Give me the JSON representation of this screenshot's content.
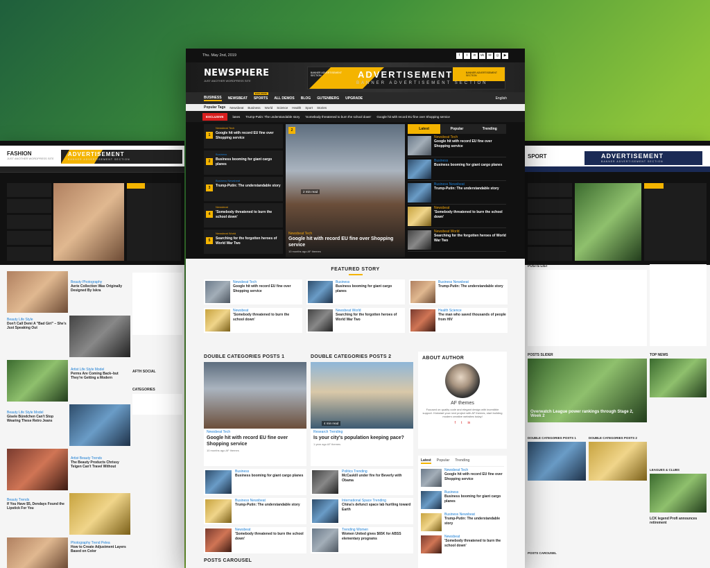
{
  "main": {
    "date": "Thu. May 2nd, 2019",
    "social": [
      "f",
      "t",
      "in",
      "vk",
      "✉",
      "◎",
      "▶"
    ],
    "logo": "NEWSPHERE",
    "slogan": "JUST ANOTHER WORDPRESS SITE",
    "ad": {
      "big": "ADVERTISEMENT",
      "sub": "BANNER ADVERTISEMENT SECTION",
      "small_left": "BANNER ADVERTISEMENT SECTION",
      "small_right": "BANNER ADVERTISEMENT SECTION"
    },
    "nav": [
      "BUSINESS",
      "NEWSBEAT",
      "SPORTS",
      "ALL DEMOS",
      "BLOG",
      "GUTENBERG",
      "UPGRADE"
    ],
    "nav_badge": "EXCLUSIVE",
    "lang": "English",
    "popular_label": "Popular Tags",
    "popular_tags": [
      "Newsbeat",
      "Business",
      "World",
      "Science",
      "Health",
      "Sport",
      "Stories"
    ],
    "ticker_label": "EXCLUSIVE",
    "ticker": [
      "lanes",
      "Trump-Putin: The understandable story",
      "'Somebody threatened to burn the school down'",
      "Google hit with record EU fine over Shopping service"
    ],
    "numbered": [
      {
        "n": "1",
        "cat": "Newsbeat  Tech",
        "title": "Google hit with record EU fine over Shopping service"
      },
      {
        "n": "2",
        "cat": "Business",
        "title": "Business booming for giant cargo planes"
      },
      {
        "n": "3",
        "cat": "Business  Newsbeat",
        "title": "Trump-Putin: The understandable story"
      },
      {
        "n": "4",
        "cat": "Newsbeat",
        "title": "'Somebody threatened to burn the school down'"
      },
      {
        "n": "5",
        "cat": "Newsbeat  World",
        "title": "Searching for the forgotten heroes of World War Two"
      }
    ],
    "hero": {
      "cat": "Newsbeat  Tech",
      "title": "Google hit with record EU fine over Shopping service",
      "meta": "10 months ago   AF themes",
      "badge": "2",
      "read": "2 min read"
    },
    "tabs": [
      "Latest",
      "Popular",
      "Trending"
    ],
    "tab_items": [
      {
        "cat": "Newsbeat  Tech",
        "title": "Google hit with record EU fine over Shopping service"
      },
      {
        "cat": "Business",
        "title": "Business booming for giant cargo planes"
      },
      {
        "cat": "Business  Newsbeat",
        "title": "Trump-Putin: The understandable story"
      },
      {
        "cat": "Newsbeat",
        "title": "'Somebody threatened to burn the school down'"
      },
      {
        "cat": "Newsbeat  World",
        "title": "Searching for the forgotten heroes of World War Two"
      }
    ],
    "featured_title": "FEATURED STORY",
    "featured": [
      {
        "cat": "Newsbeat  Tech",
        "title": "Google hit with record EU fine over Shopping service"
      },
      {
        "cat": "Business",
        "title": "Business booming for giant cargo planes"
      },
      {
        "cat": "Business  Newsbeat",
        "title": "Trump-Putin: The understandable story"
      },
      {
        "cat": "Newsbeat",
        "title": "'Somebody threatened to burn the school down'"
      },
      {
        "cat": "Newsbeat  World",
        "title": "Searching for the forgotten heroes of World War Two"
      },
      {
        "cat": "Health  Science",
        "title": "The man who saved thousands of people from HIV"
      }
    ],
    "dc1": {
      "title": "DOUBLE CATEGORIES POSTS 1",
      "big_cat": "Newsbeat  Tech",
      "big_title": "Google hit with record EU fine over Shopping service",
      "big_meta": "10 months ago   AF themes",
      "items": [
        {
          "cat": "Business",
          "title": "Business booming for giant cargo planes"
        },
        {
          "cat": "Business  Newsbeat",
          "title": "Trump-Putin: The understandable story"
        },
        {
          "cat": "Newsbeat",
          "title": "'Somebody threatened to burn the school down'"
        }
      ]
    },
    "dc2": {
      "title": "DOUBLE CATEGORIES POSTS 2",
      "big_cat": "Research  Trending",
      "big_title": "Is your city's population keeping pace?",
      "big_meta": "1 year ago   AF themes",
      "read": "4 min read",
      "items": [
        {
          "cat": "Politics  Trending",
          "title": "McCaskill under fire for Beverly with Obama"
        },
        {
          "cat": "International  Space  Trending",
          "title": "China's defunct space lab hurtling toward Earth"
        },
        {
          "cat": "Trending  Women",
          "title": "Women United gives $65K for ABSS elementary programs"
        }
      ]
    },
    "about": {
      "title": "ABOUT AUTHOR",
      "name": "AF themes",
      "bio": "Focused on quality code and elegant design with incredible support. Kickstart your next project with AF themes, start building modern creative websites today!",
      "social": [
        "f",
        "t",
        "in"
      ]
    },
    "btabs": [
      "Latest",
      "Popular",
      "Trending"
    ],
    "btab_items": [
      {
        "cat": "Newsbeat  Tech",
        "title": "Google hit with record EU fine over Shopping service"
      },
      {
        "cat": "Business",
        "title": "Business booming for giant cargo planes"
      },
      {
        "cat": "Business  Newsbeat",
        "title": "Trump-Putin: The understandable story"
      },
      {
        "cat": "Newsbeat",
        "title": "'Somebody threatened to burn the school down'"
      }
    ],
    "carousel_title": "POSTS CAROUSEL"
  },
  "left": {
    "logo": "FASHION",
    "slogan": "JUST ANOTHER WORDPRESS SITE",
    "ad": "ADVERTISEMENT",
    "ad_sub": "BANNER ADVERTISEMENT SECTION",
    "posts": [
      {
        "cat": "Beauty  Photography",
        "title": "Aerie Collection Was Originally Designed By Iskra"
      },
      {
        "cat": "Beauty  Life Style",
        "title": "Don't Call Demi A \"Bad Girl\" – She's Just Speaking Out"
      },
      {
        "cat": "Artist  Life Style  Model",
        "title": "Perms Are Coming Back–but They're Getting a Modern"
      },
      {
        "cat": "Beauty  Life Style  Model",
        "title": "Gisele Bündchen Can't Stop Wearing These Retro Jeans"
      },
      {
        "cat": "Artist  Beauty  Trends",
        "title": "The Beauty Products Chrissy Teigen Can't Travel Without"
      },
      {
        "cat": "Beauty  Trends",
        "title": "If You Have $5, Dendays Found the Lipstick For You"
      },
      {
        "cat": "Photography  Trend  Pelea",
        "title": "How to Create Adjustment Layers Based on Color"
      }
    ],
    "widget_title": "AFTH SOCIAL",
    "cat_title": "CATEGORIES"
  },
  "right": {
    "logo": "SPORT",
    "ad": "ADVERTISEMENT",
    "ad_sub": "BANNER ADVERTISEMENT SECTION",
    "posts_list": "POSTS LIST",
    "slider": "POSTS SLIDER",
    "top_news": "TOP NEWS",
    "slider_title": "Overwatch League power rankings through Stage 2, Week 2",
    "dc1": "DOUBLE CATEGORIES POSTS 1",
    "dc2": "DOUBLE CATEGORIES POSTS 2",
    "leagues": "LEAGUES & CLUBS",
    "carousel": "POSTS CAROUSEL",
    "lcks": "LCK legend Profi announces retirement"
  }
}
